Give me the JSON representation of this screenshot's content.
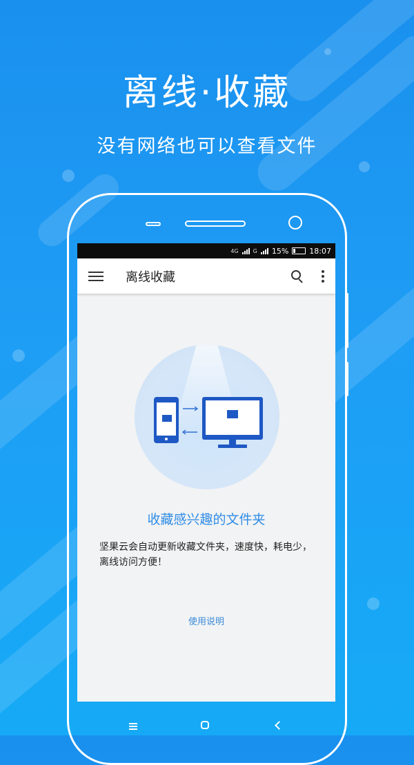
{
  "banner": {
    "title": "离线·收藏",
    "subtitle": "没有网络也可以查看文件"
  },
  "device": {
    "status_bar": {
      "network_label": "4G",
      "carrier2_label": "G",
      "battery": "15%",
      "time": "18:07"
    },
    "app_bar": {
      "title": "离线收藏",
      "menu_icon": "hamburger-menu-icon",
      "search_icon": "search-icon",
      "more_icon": "more-vertical-icon"
    },
    "content": {
      "illustration": "phone-and-monitor-sync-illustration",
      "title": "收藏感兴趣的文件夹",
      "description": "坚果云会自动更新收藏文件夹，速度快，耗电少，离线访问方便！",
      "help_link": "使用说明"
    },
    "nav_keys": [
      "menu-icon",
      "home-icon",
      "back-icon"
    ]
  },
  "colors": {
    "background_top": "#1a90ee",
    "background_bottom": "#16aaf6",
    "accent": "#2f8ce6",
    "device_blue": "#1e58c4"
  }
}
